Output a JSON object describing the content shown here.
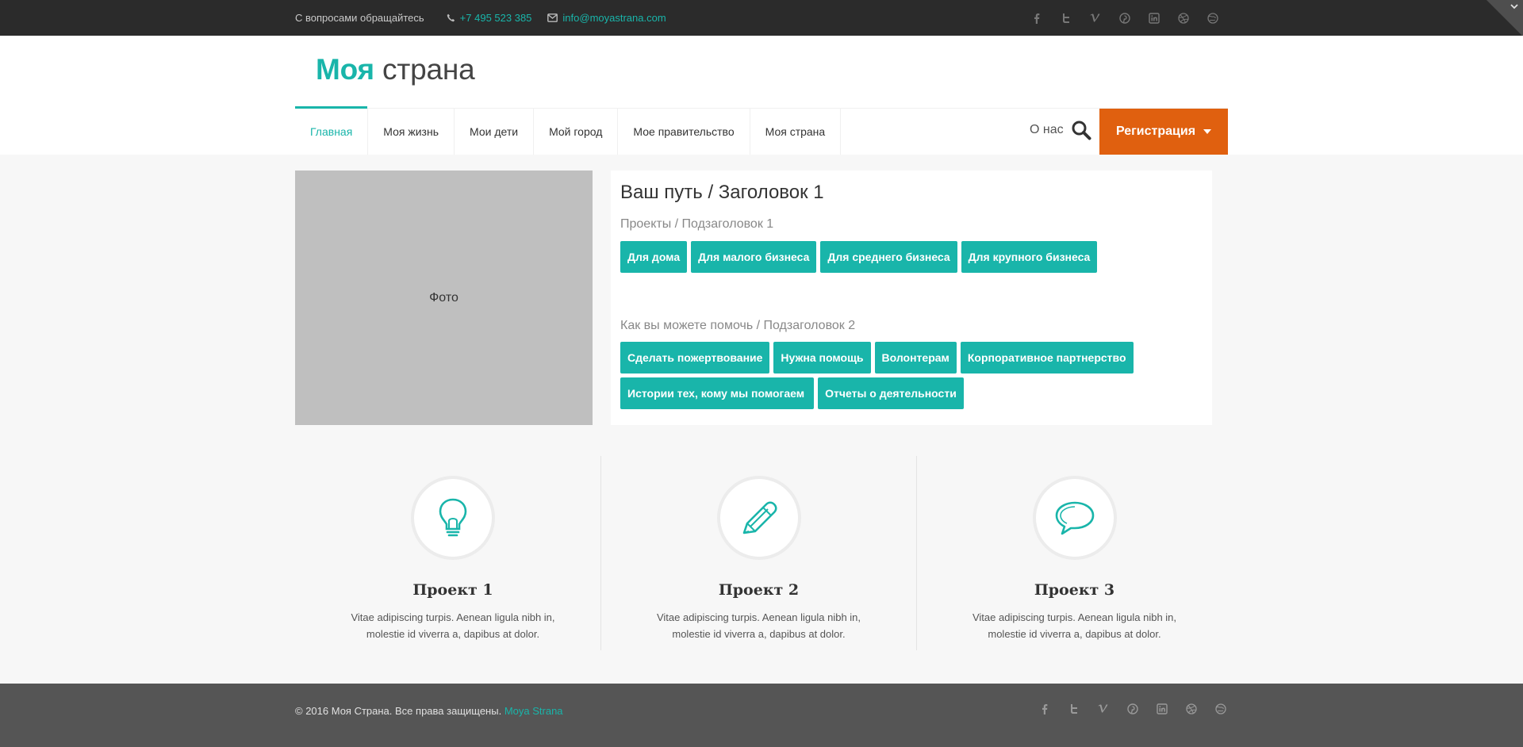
{
  "topbar": {
    "contact_text": "С вопросами обращайтесь",
    "phone": "+7 495 523 385",
    "email": "info@moyastrana.com",
    "social_icons": [
      "facebook-icon",
      "twitter-icon",
      "vimeo-icon",
      "pinterest-icon",
      "linkedin-icon",
      "dribbble-icon",
      "globe-icon"
    ]
  },
  "header": {
    "logo_bold": "Моя",
    "logo_thin": "страна",
    "nav": [
      {
        "label": "Главная",
        "active": true
      },
      {
        "label": "Моя жизнь"
      },
      {
        "label": "Мои дети"
      },
      {
        "label": "Мой город"
      },
      {
        "label": "Мое правительство"
      },
      {
        "label": "Моя страна"
      }
    ],
    "about": "О нас",
    "register": "Регистрация"
  },
  "main": {
    "photo_label": "Фото",
    "title": "Ваш путь / Заголовок 1",
    "subtitle1": "Проекты / Подзаголовок 1",
    "buttons1": [
      "Для дома",
      "Для малого бизнеса",
      "Для среднего бизнеса",
      "Для крупного бизнеса"
    ],
    "subtitle2": "Как вы можете помочь / Подзаголовок 2",
    "buttons2_row1": [
      "Сделать пожертвование",
      "Нужна помощь",
      "Волонтерам",
      "Корпоративное партнерство"
    ],
    "buttons2_row2": [
      "Истории тех, кому мы помогаем",
      "Отчеты о деятельности"
    ]
  },
  "features": [
    {
      "icon": "lightbulb-icon",
      "title": "Проект 1",
      "line1": "Vitae adipiscing turpis. Aenean ligula nibh in,",
      "line2": "molestie id viverra a, dapibus at dolor."
    },
    {
      "icon": "pencil-icon",
      "title": "Проект 2",
      "line1": "Vitae adipiscing turpis. Aenean ligula nibh in,",
      "line2": "molestie id viverra a, dapibus at dolor."
    },
    {
      "icon": "speech-bubble-icon",
      "title": "Проект 3",
      "line1": "Vitae adipiscing turpis. Aenean ligula nibh in,",
      "line2": "molestie id viverra a, dapibus at dolor."
    }
  ],
  "footer": {
    "copyright": "© 2016 Моя Страна. Все права защищены.",
    "link": "Moya Strana"
  },
  "colors": {
    "accent": "#19b5aa",
    "register": "#e0600f",
    "topbar": "#2b2b2b",
    "footer": "#555555"
  }
}
